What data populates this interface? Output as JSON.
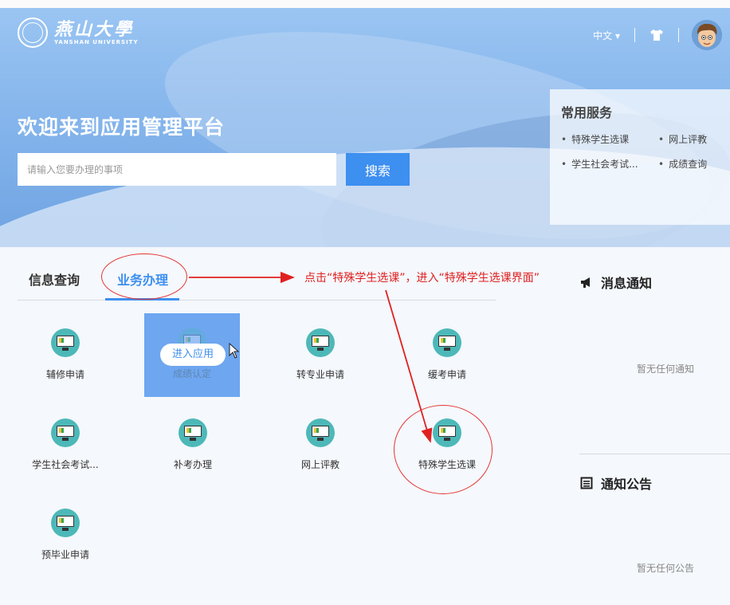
{
  "header": {
    "logo_cn": "燕山大學",
    "logo_en": "YANSHAN UNIVERSITY",
    "language": "中文",
    "language_caret": "▾"
  },
  "hero": {
    "welcome": "欢迎来到应用管理平台",
    "search_placeholder": "请输入您要办理的事项",
    "search_button": "搜索"
  },
  "services": {
    "title": "常用服务",
    "items": [
      "特殊学生选课",
      "网上评教",
      "学生社会考试...",
      "成绩查询"
    ]
  },
  "tabs": [
    {
      "label": "信息查询",
      "active": false
    },
    {
      "label": "业务办理",
      "active": true
    }
  ],
  "annotation": "点击“特殊学生选课”，进入“特殊学生选课界面”",
  "apps": [
    {
      "label": "辅修申请"
    },
    {
      "label": "成绩认定",
      "hover_button": "进入应用"
    },
    {
      "label": "转专业申请"
    },
    {
      "label": "缓考申请"
    },
    {
      "label": "学生社会考试..."
    },
    {
      "label": "补考办理"
    },
    {
      "label": "网上评教"
    },
    {
      "label": "特殊学生选课"
    },
    {
      "label": "预毕业申请"
    }
  ],
  "messages": {
    "title": "消息通知",
    "empty": "暂无任何通知"
  },
  "notices": {
    "title": "通知公告",
    "empty": "暂无任何公告"
  },
  "colors": {
    "accent": "#3d8ff0",
    "annotation": "#e02020",
    "icon_bg": "#4db8b8"
  },
  "icons": [
    "tshirt-icon",
    "avatar",
    "monitor-icon",
    "megaphone-icon",
    "list-icon",
    "cursor-icon"
  ]
}
